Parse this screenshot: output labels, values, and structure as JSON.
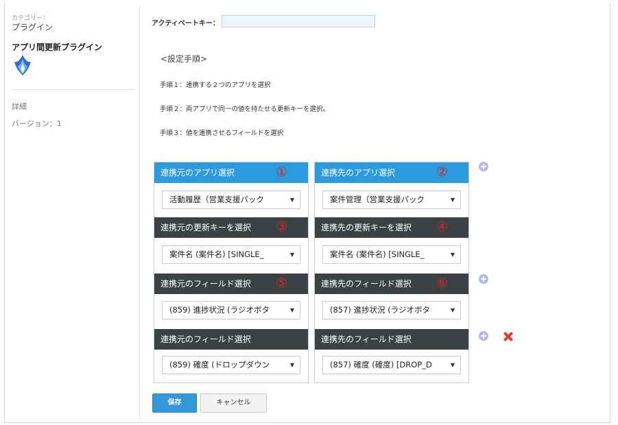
{
  "sidebar": {
    "category_label": "カテゴリー：",
    "category_value": "プラグイン",
    "plugin_name": "アプリ間更新プラグイン",
    "detail": "詳細",
    "version": "バージョン：1"
  },
  "activation": {
    "label": "アクティベートキー：",
    "value": ""
  },
  "steps": {
    "title": "<設定手順>",
    "items": [
      "手順１：連携する２つのアプリを選択",
      "手順２：両アプリで同一の値を持たせる更新キーを選択。",
      "手順３：値を連携させるフィールドを選択"
    ]
  },
  "source": {
    "app_header": "連携元のアプリ選択",
    "app_num": "①",
    "app_value": "活動履歴（営業支援パック",
    "key_header": "連携元の更新キーを選択",
    "key_num": "③",
    "key_value": "案件名 (案件名) [SINGLE_",
    "field1_header": "連携元のフィールド選択",
    "field1_num": "⑤",
    "field1_value": "(859) 進捗状況 (ラジオボタ",
    "field2_header": "連携元のフィールド選択",
    "field2_value": "(859) 確度 (ドロップダウン"
  },
  "dest": {
    "app_header": "連携先のアプリ選択",
    "app_num": "②",
    "app_value": "案件管理（営業支援パック",
    "key_header": "連携先の更新キーを選択",
    "key_num": "④",
    "key_value": "案件名 (案件名) [SINGLE_",
    "field1_header": "連携先のフィールド選択",
    "field1_num": "⑥",
    "field1_value": "(857) 進捗状況 (ラジオボタ",
    "field2_header": "連携先のフィールド選択",
    "field2_value": "(857) 確度 (確度) [DROP_D"
  },
  "buttons": {
    "save": "保存",
    "cancel": "キャンセル"
  },
  "icons": {
    "add": "plus-circle-icon",
    "delete": "close-x-icon",
    "dropdown": "triangle-down-icon",
    "logo": "plugin-logo-icon"
  },
  "colors": {
    "header_blue": "#2b9adf",
    "header_dark": "#3a4246",
    "number_red": "#e2211c",
    "save_blue": "#3498db",
    "add_lavender": "#b3b7e4",
    "delete_red": "#e83b2e"
  }
}
